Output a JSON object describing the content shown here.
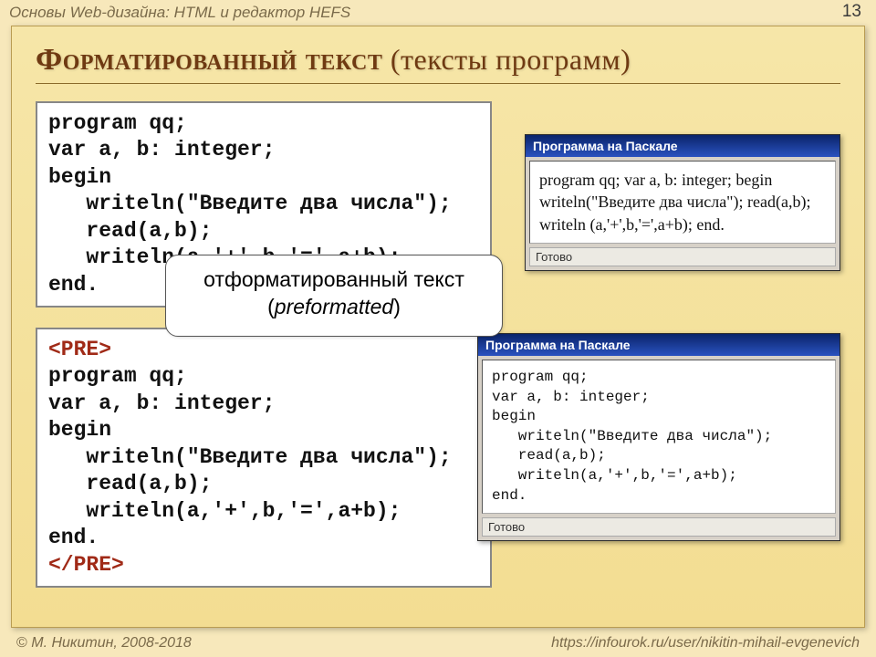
{
  "topbar": "Основы Web-дизайна: HTML и редактор HEFS",
  "page_number": "13",
  "title_main": "Форматированный текст",
  "title_sub": "(тексты программ)",
  "code_top": "program qq;\nvar a, b: integer;\nbegin\n   writeln(\"Введите два числа\");\n   read(a,b);\n   writeln(a,'+',b,'=',a+b);\nend.",
  "code_bot_open": "<PRE>",
  "code_bot_body": "program qq;\nvar a, b: integer;\nbegin\n   writeln(\"Введите два числа\");\n   read(a,b);\n   writeln(a,'+',b,'=',a+b);\nend.",
  "code_bot_close": "</PRE>",
  "browser": {
    "title": "Программа на Паскале",
    "status": "Готово",
    "body_top": "program qq; var a, b: integer; begin writeln(\"Введите два числа\"); read(a,b); writeln (a,'+',b,'=',a+b); end.",
    "body_bot": "program qq;\nvar a, b: integer;\nbegin\n   writeln(\"Введите два числа\");\n   read(a,b);\n   writeln(a,'+',b,'=',a+b);\nend."
  },
  "callout": {
    "line1": "отформатированный текст",
    "line2_prefix": "(",
    "line2_ital": "preformatted",
    "line2_suffix": ")"
  },
  "footer": {
    "left": "М. Никитин, 2008-2018",
    "right": "https://infourok.ru/user/nikitin-mihail-evgenevich"
  }
}
